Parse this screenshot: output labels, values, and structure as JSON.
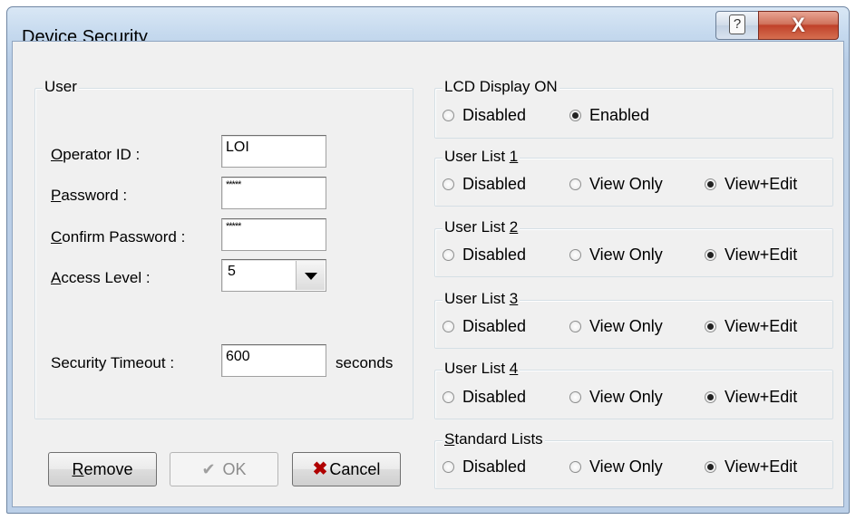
{
  "window": {
    "title": "Device Security",
    "help_glyph": "?",
    "close_glyph": "X"
  },
  "user_group": {
    "legend": "User",
    "operator_id": {
      "label_mn": "O",
      "label_rest": "perator ID :",
      "value": "LOI"
    },
    "password": {
      "label_mn": "P",
      "label_rest": "assword :",
      "value": "*****"
    },
    "confirm_password": {
      "label_mn": "C",
      "label_rest": "onfirm Password :",
      "value": "*****"
    },
    "access_level": {
      "label_mn": "A",
      "label_rest": "ccess Level :",
      "value": "5"
    },
    "security_timeout": {
      "label": "Security Timeout :",
      "value": "600",
      "unit": "seconds"
    }
  },
  "buttons": {
    "remove": {
      "mn": "R",
      "rest": "emove"
    },
    "ok": {
      "label": "OK",
      "icon": "✔"
    },
    "cancel": {
      "label": "Cancel",
      "icon": "✖"
    }
  },
  "lcd_display": {
    "legend": "LCD Display ON",
    "options": [
      "Disabled",
      "Enabled"
    ],
    "selected": "Enabled"
  },
  "user_lists": [
    {
      "legend_text": "User List ",
      "legend_mn": "1",
      "options": [
        "Disabled",
        "View Only",
        "View+Edit"
      ],
      "selected": "View+Edit"
    },
    {
      "legend_text": "User List ",
      "legend_mn": "2",
      "options": [
        "Disabled",
        "View Only",
        "View+Edit"
      ],
      "selected": "View+Edit"
    },
    {
      "legend_text": "User List ",
      "legend_mn": "3",
      "options": [
        "Disabled",
        "View Only",
        "View+Edit"
      ],
      "selected": "View+Edit"
    },
    {
      "legend_text": "User List ",
      "legend_mn": "4",
      "options": [
        "Disabled",
        "View Only",
        "View+Edit"
      ],
      "selected": "View+Edit"
    }
  ],
  "standard_lists": {
    "legend_mn": "S",
    "legend_rest": "tandard Lists",
    "options": [
      "Disabled",
      "View Only",
      "View+Edit"
    ],
    "selected": "View+Edit"
  }
}
